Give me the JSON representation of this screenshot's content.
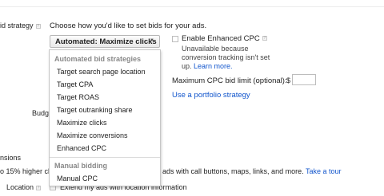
{
  "bidding": {
    "bid_strategy_label": "id strategy",
    "instructions": "Choose how you'd like to set bids for your ads.",
    "selected_strategy": "Automated: Maximize clicks",
    "dropdown": {
      "automated_group_label": "Automated bid strategies",
      "automated_items": [
        "Target search page location",
        "Target CPA",
        "Target ROAS",
        "Target outranking share",
        "Maximize clicks",
        "Maximize conversions",
        "Enhanced CPC"
      ],
      "manual_group_label": "Manual bidding",
      "manual_items": [
        "Manual CPC"
      ]
    },
    "enhanced_cpc": {
      "label": "Enable Enhanced CPC",
      "unavailable_line1": "Unavailable because",
      "unavailable_line2": "conversion tracking isn't set",
      "unavailable_line3": "up.",
      "learn_more": "Learn more."
    },
    "max_cpc": {
      "label": "Maximum CPC bid limit (optional):",
      "currency": "$",
      "value": ""
    },
    "portfolio_link": "Use a portfolio strategy"
  },
  "budget": {
    "label": "Budget"
  },
  "extensions": {
    "section_label": "nsions",
    "text_left": "o 15% higher cl",
    "text_right": "ads with call buttons, maps, links, and more.",
    "tour_link": "Take a tour",
    "location_label": "Location",
    "location_text_partial": "Extend my ads with location information"
  }
}
